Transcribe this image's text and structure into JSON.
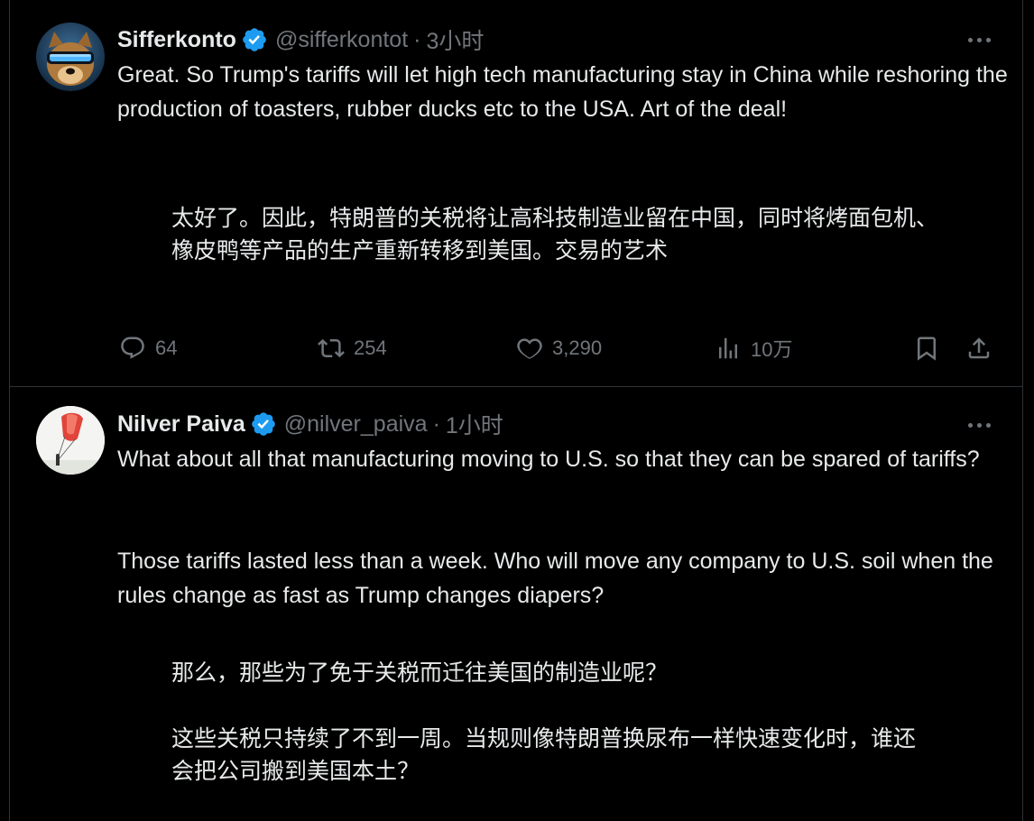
{
  "posts": [
    {
      "name": "Sifferkonto",
      "handle": "@sifferkontot",
      "separator": "·",
      "time": "3小时",
      "text_en": "Great. So Trump's tariffs will let high tech manufacturing stay in China while reshoring the production of toasters, rubber ducks etc to the USA. Art of the deal!",
      "text_zh": "太好了。因此，特朗普的关税将让高科技制造业留在中国，同时将烤面包机、橡皮鸭等产品的生产重新转移到美国。交易的艺术",
      "actions": {
        "replies": "64",
        "reposts": "254",
        "likes": "3,290",
        "views": "10万"
      },
      "avatar_icon": "dog-with-vr-headset-avatar"
    },
    {
      "name": "Nilver Paiva",
      "handle": "@nilver_paiva",
      "separator": "·",
      "time": "1小时",
      "text_en_p1": "What about all that manufacturing moving to U.S. so that they can be spared of tariffs?",
      "text_en_p2": "Those tariffs lasted less than a week. Who will move any company to U.S. soil when the rules change as fast as Trump changes diapers?",
      "text_zh_p1": "那么，那些为了免于关税而迁往美国的制造业呢？",
      "text_zh_p2": "这些关税只持续了不到一周。当规则像特朗普换尿布一样快速变化时，谁还会把公司搬到美国本土？",
      "avatar_icon": "paraglider-avatar"
    }
  ],
  "colors": {
    "background": "#000000",
    "text": "#e7e9ea",
    "muted": "#71767b",
    "verified": "#1d9bf0",
    "divider": "#2f3336"
  }
}
